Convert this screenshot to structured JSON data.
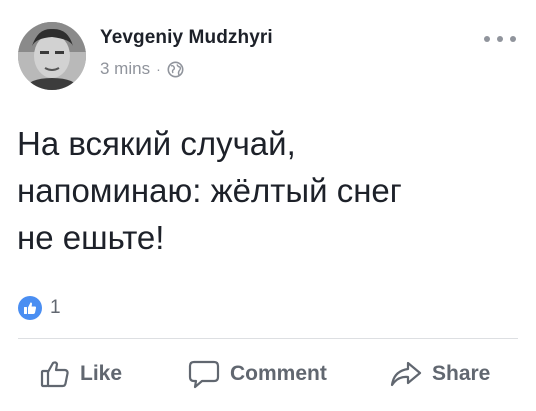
{
  "post": {
    "author": "Yevgeniy Mudzhyri",
    "time": "3 mins",
    "separator": "·",
    "privacy_icon": "globe-icon",
    "text": "На всякий случай,\nнапоминаю: жёлтый снег\nне ешьте!",
    "reactions": {
      "icon": "like-reaction-icon",
      "count": "1"
    }
  },
  "actions": {
    "like_label": "Like",
    "comment_label": "Comment",
    "share_label": "Share"
  },
  "colors": {
    "text": "#1d2129",
    "secondary": "#90949c",
    "action": "#616770",
    "like_blue": "#4a8ef2",
    "divider": "#dddfe2"
  }
}
